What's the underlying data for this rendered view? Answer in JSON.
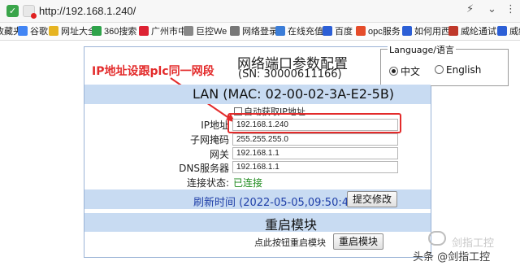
{
  "browser": {
    "url": "http://192.168.1.240/",
    "bookmarks": [
      "收藏夹",
      "谷歌",
      "网址大全",
      "360搜索",
      "广州市中",
      "巨控We",
      "网络登录",
      "在线充值",
      "百度",
      "opc服务",
      "如何用西",
      "威纶通试",
      "威纶通"
    ]
  },
  "header": {
    "title": "网络端口参数配置",
    "sn": "(SN: 30000611166)"
  },
  "language": {
    "legend": "Language/语言",
    "options": [
      "中文",
      "English"
    ],
    "selected": "中文"
  },
  "annotation": "IP地址设跟plc同一网段",
  "lan": {
    "title": "LAN (MAC: 02-00-02-3A-E2-5B)",
    "dhcp_label": "自动获取IP地址",
    "dhcp_checked": false,
    "fields": [
      {
        "label": "IP地址",
        "value": "192.168.1.240"
      },
      {
        "label": "子网掩码",
        "value": "255.255.255.0"
      },
      {
        "label": "网关",
        "value": "192.168.1.1"
      },
      {
        "label": "DNS服务器",
        "value": "192.168.1.1"
      }
    ],
    "status_label": "连接状态:",
    "status_value": "已连接"
  },
  "refresh": {
    "text": "刷新时间 (2022-05-05,09:50:49)",
    "submit_label": "提交修改"
  },
  "reboot": {
    "title": "重启模块",
    "hint": "点此按钮重启模块",
    "button_label": "重启模块"
  },
  "watermark": {
    "text": "头条 @剑指工控",
    "faded": "剑指工控"
  },
  "colors": {
    "band": "#c8dbf2",
    "annotation": "#e32b2b",
    "status": "#1d8a1d",
    "refresh": "#1f3fa8"
  }
}
